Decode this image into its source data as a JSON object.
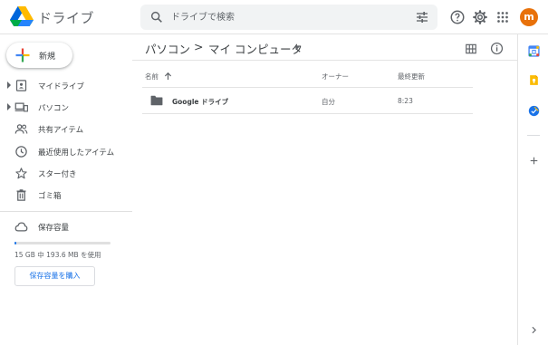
{
  "app": {
    "title": "ドライブ"
  },
  "search": {
    "placeholder": "ドライブで検索"
  },
  "header": {
    "avatar_letter": "m"
  },
  "sidebar": {
    "new_label": "新規",
    "items": [
      {
        "label": "マイドライブ",
        "icon": "my-drive-icon",
        "expandable": true
      },
      {
        "label": "パソコン",
        "icon": "computers-icon",
        "expandable": true
      },
      {
        "label": "共有アイテム",
        "icon": "shared-icon",
        "expandable": false
      },
      {
        "label": "最近使用したアイテム",
        "icon": "clock-icon",
        "expandable": false
      },
      {
        "label": "スター付き",
        "icon": "star-icon",
        "expandable": false
      },
      {
        "label": "ゴミ箱",
        "icon": "trash-icon",
        "expandable": false
      }
    ],
    "storage": {
      "label": "保存容量",
      "usage_text": "15 GB 中 193.6 MB を使用",
      "used_fraction": 0.013,
      "buy_label": "保存容量を購入"
    }
  },
  "main": {
    "breadcrumb": {
      "root": "パソコン",
      "separator": ">",
      "current": "マイ コンピュータ"
    },
    "columns": {
      "name": "名前",
      "owner": "オーナー",
      "modified": "最終更新"
    },
    "rows": [
      {
        "name": "Google ドライブ",
        "owner": "自分",
        "modified": "8:23",
        "icon": "folder-icon"
      }
    ]
  },
  "colors": {
    "accent": "#1a73e8",
    "avatar": "#e8710a",
    "search_bg": "#f1f3f4"
  }
}
